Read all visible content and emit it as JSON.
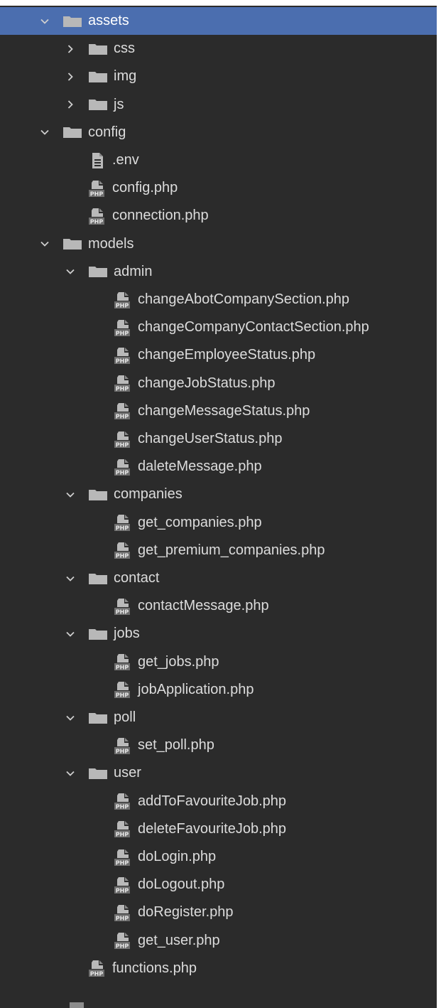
{
  "colors": {
    "background": "#2b2b2b",
    "selection": "#4b6eaf",
    "text": "#dcdcdc",
    "folder": "#b8b8b8",
    "php_badge": "#6e6e6e"
  },
  "tree": [
    {
      "label": "assets",
      "type": "folder",
      "depth": 0,
      "expanded": true,
      "selected": true
    },
    {
      "label": "css",
      "type": "folder",
      "depth": 1,
      "expanded": false
    },
    {
      "label": "img",
      "type": "folder",
      "depth": 1,
      "expanded": false
    },
    {
      "label": "js",
      "type": "folder",
      "depth": 1,
      "expanded": false
    },
    {
      "label": "config",
      "type": "folder",
      "depth": 0,
      "expanded": true
    },
    {
      "label": ".env",
      "type": "env",
      "depth": 1
    },
    {
      "label": "config.php",
      "type": "php",
      "depth": 1
    },
    {
      "label": "connection.php",
      "type": "php",
      "depth": 1
    },
    {
      "label": "models",
      "type": "folder",
      "depth": 0,
      "expanded": true
    },
    {
      "label": "admin",
      "type": "folder",
      "depth": 1,
      "expanded": true
    },
    {
      "label": "changeAbotCompanySection.php",
      "type": "php",
      "depth": 2
    },
    {
      "label": "changeCompanyContactSection.php",
      "type": "php",
      "depth": 2
    },
    {
      "label": "changeEmployeeStatus.php",
      "type": "php",
      "depth": 2
    },
    {
      "label": "changeJobStatus.php",
      "type": "php",
      "depth": 2
    },
    {
      "label": "changeMessageStatus.php",
      "type": "php",
      "depth": 2
    },
    {
      "label": "changeUserStatus.php",
      "type": "php",
      "depth": 2
    },
    {
      "label": "daleteMessage.php",
      "type": "php",
      "depth": 2
    },
    {
      "label": "companies",
      "type": "folder",
      "depth": 1,
      "expanded": true
    },
    {
      "label": "get_companies.php",
      "type": "php",
      "depth": 2
    },
    {
      "label": "get_premium_companies.php",
      "type": "php",
      "depth": 2
    },
    {
      "label": "contact",
      "type": "folder",
      "depth": 1,
      "expanded": true
    },
    {
      "label": "contactMessage.php",
      "type": "php",
      "depth": 2
    },
    {
      "label": "jobs",
      "type": "folder",
      "depth": 1,
      "expanded": true
    },
    {
      "label": "get_jobs.php",
      "type": "php",
      "depth": 2
    },
    {
      "label": "jobApplication.php",
      "type": "php",
      "depth": 2
    },
    {
      "label": "poll",
      "type": "folder",
      "depth": 1,
      "expanded": true
    },
    {
      "label": "set_poll.php",
      "type": "php",
      "depth": 2
    },
    {
      "label": "user",
      "type": "folder",
      "depth": 1,
      "expanded": true
    },
    {
      "label": "addToFavouriteJob.php",
      "type": "php",
      "depth": 2
    },
    {
      "label": "deleteFavouriteJob.php",
      "type": "php",
      "depth": 2
    },
    {
      "label": "doLogin.php",
      "type": "php",
      "depth": 2
    },
    {
      "label": "doLogout.php",
      "type": "php",
      "depth": 2
    },
    {
      "label": "doRegister.php",
      "type": "php",
      "depth": 2
    },
    {
      "label": "get_user.php",
      "type": "php",
      "depth": 2
    },
    {
      "label": "functions.php",
      "type": "php",
      "depth": 1
    }
  ]
}
